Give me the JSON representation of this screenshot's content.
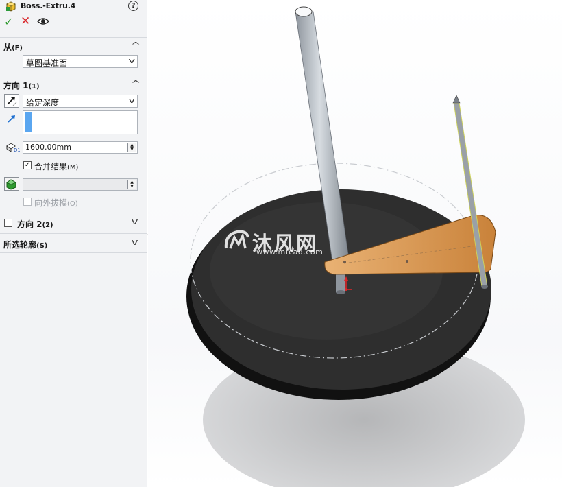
{
  "feature": {
    "title": "Boss.-Extru.4",
    "help_icon": "?"
  },
  "actions": {
    "ok_icon": "✓",
    "cancel_icon": "✕"
  },
  "from_section": {
    "label": "从",
    "shortcut": "(F)",
    "start_condition": "草图基准面"
  },
  "direction1": {
    "label": "方向 1",
    "shortcut": "(1)",
    "end_condition": "给定深度",
    "depth": "1600.00mm",
    "merge_label": "合并结果",
    "merge_shortcut": "(M)",
    "merge_checked": true,
    "draft_label": "向外拔模",
    "draft_shortcut": "(O)",
    "draft_checked": false
  },
  "direction2": {
    "label": "方向 2",
    "shortcut": "(2)",
    "checked": false
  },
  "selected_contours": {
    "label": "所选轮廓",
    "shortcut": "(S)"
  },
  "watermark": {
    "cn": "沐风网",
    "en": "www.mfcad.com"
  },
  "colors": {
    "panel_bg": "#f2f3f5",
    "ok_green": "#2f9a2f",
    "cancel_red": "#d9262a",
    "selection_blue": "#5aa6f0",
    "disc": "#2e2e2e",
    "wood": "#d99850",
    "pole": "#b9bfc7"
  }
}
